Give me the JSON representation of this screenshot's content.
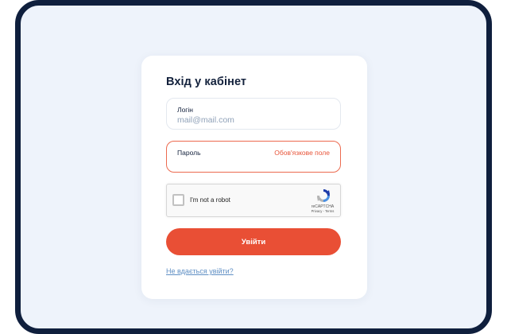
{
  "login_form": {
    "title": "Вхід у кабінет",
    "login_field": {
      "label": "Логін",
      "placeholder": "mail@mail.com"
    },
    "password_field": {
      "label": "Пароль",
      "error": "Обов'язкове поле"
    },
    "captcha": {
      "label": "I'm not a robot",
      "brand": "reCAPTCHA",
      "links": "Privacy - Terms",
      "icon": "recaptcha-icon"
    },
    "submit_label": "Увійти",
    "help_link": "Не вдається увійти?"
  },
  "colors": {
    "accent": "#e94f35",
    "error": "#e8553a",
    "background": "#eef3fb",
    "frame": "#0f1f3d",
    "link": "#5f8fc4"
  }
}
